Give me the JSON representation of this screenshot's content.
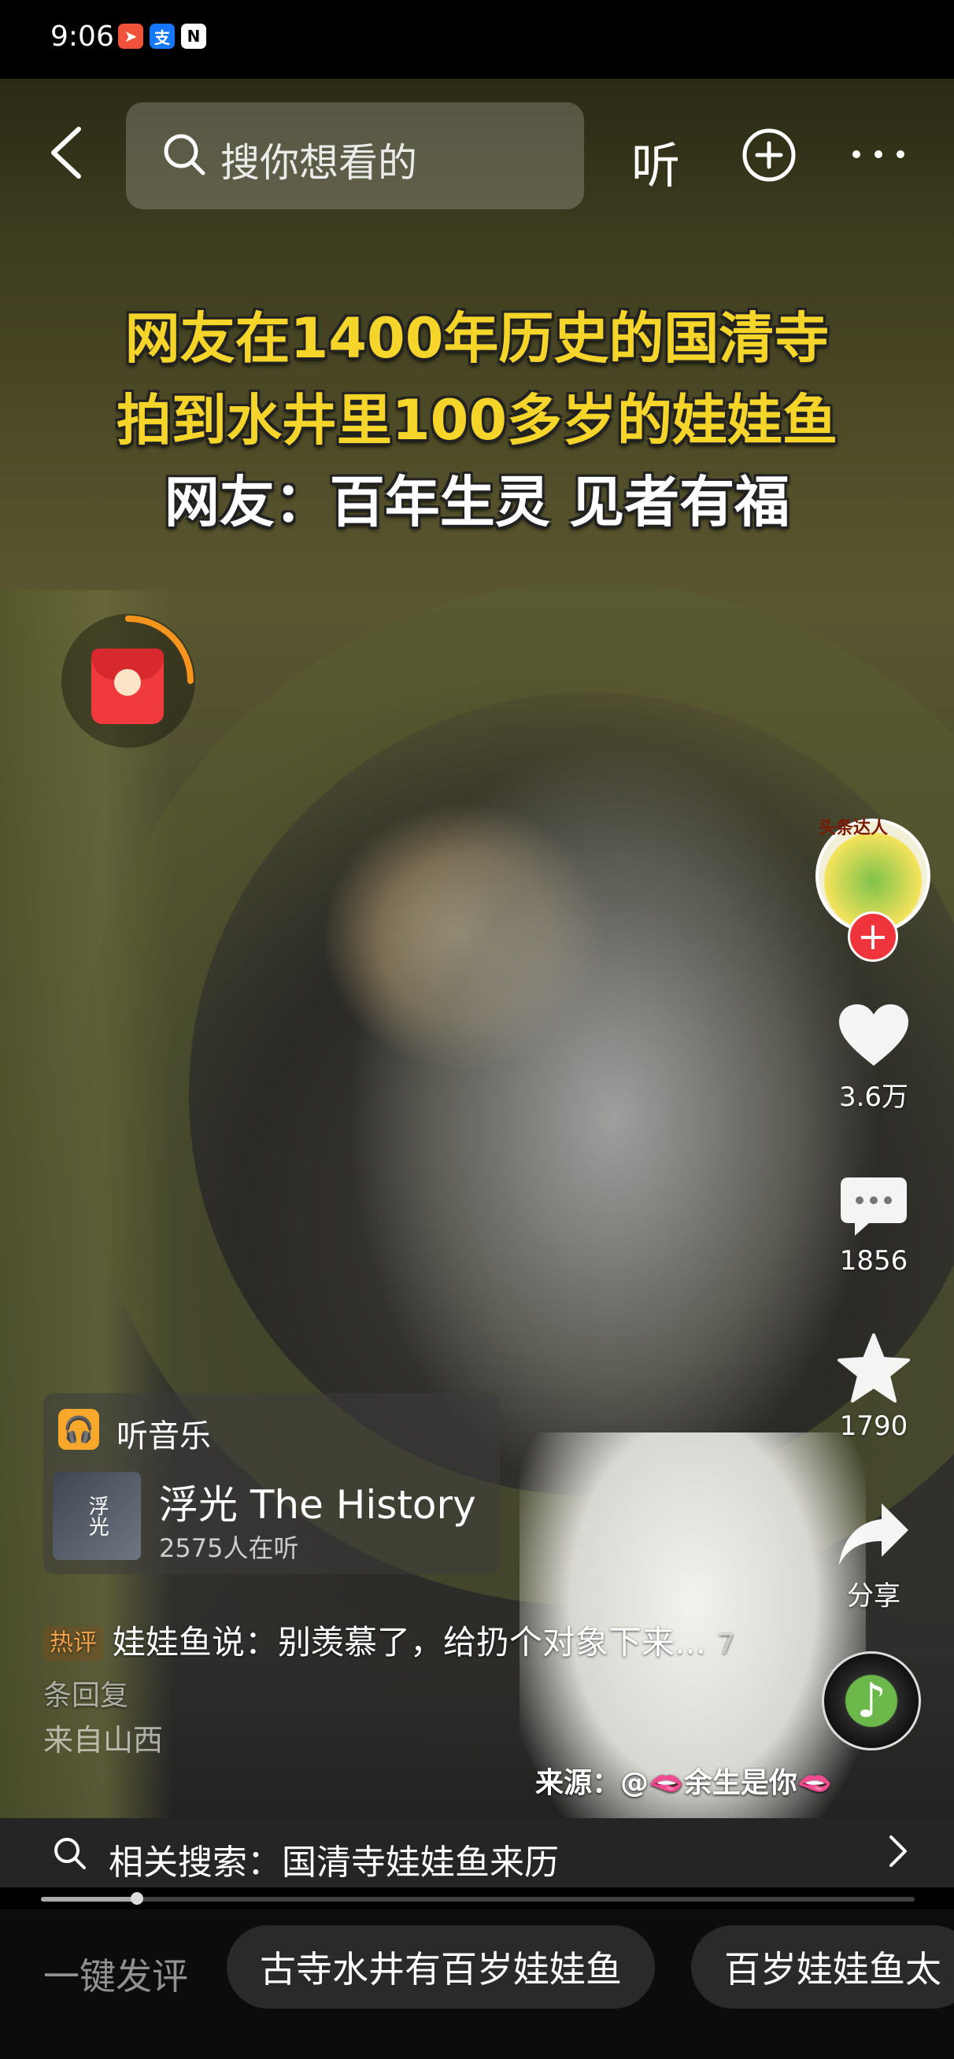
{
  "status_bar": {
    "time": "9:06",
    "app_icons": [
      "send-app-icon",
      "alipay-icon",
      "nfc-icon"
    ]
  },
  "top_bar": {
    "search_placeholder": "搜你想看的",
    "listen_label": "听"
  },
  "video": {
    "headline": [
      "网友在1400年历史的国清寺",
      "拍到水井里100多岁的娃娃鱼",
      "网友：百年生灵 见者有福"
    ],
    "source": "来源：@🫦余生是你🫦"
  },
  "author": {
    "badge": "头条达人"
  },
  "actions": {
    "likes": "3.6万",
    "comments": "1856",
    "favorites": "1790",
    "share": "分享"
  },
  "music": {
    "header": "听音乐",
    "cover_text": "浮光",
    "song": "浮光 The History",
    "listeners": "2575人在听"
  },
  "hot_comment": {
    "tag": "热评",
    "text": "娃娃鱼说：别羡慕了，给扔个对象下来...",
    "replies": "7条回复",
    "location": "来自山西"
  },
  "related_search": {
    "text": "相关搜索：国清寺娃娃鱼来历"
  },
  "playback": {
    "progress": 0.11
  },
  "quick_comment": {
    "label": "一键发评",
    "chips": [
      "古寺水井有百岁娃娃鱼",
      "百岁娃娃鱼太"
    ]
  },
  "colors": {
    "headline_yellow": "#f6d52a",
    "like_red": "#f0343c",
    "music_orange": "#f7a82b"
  }
}
